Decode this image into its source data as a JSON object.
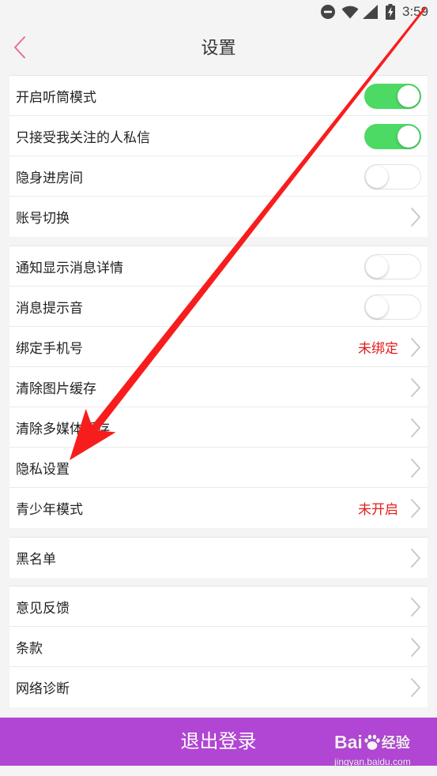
{
  "status_bar": {
    "time": "3:59",
    "icons": [
      "do-not-disturb-icon",
      "wifi-icon",
      "signal-icon",
      "battery-charging-icon"
    ]
  },
  "header": {
    "back_icon": "chevron-left-icon",
    "title": "设置"
  },
  "groups": [
    {
      "items": [
        {
          "label": "开启听筒模式",
          "toggle_on": true
        },
        {
          "label": "只接受我关注的人私信",
          "toggle_on": true
        },
        {
          "label": "隐身进房间",
          "toggle_on": false
        },
        {
          "label": "账号切换",
          "trailing_icon": "chevron-right-icon"
        }
      ]
    },
    {
      "items": [
        {
          "label": "通知显示消息详情",
          "toggle_on": false
        },
        {
          "label": "消息提示音",
          "toggle_on": false
        },
        {
          "label": "绑定手机号",
          "value": "未绑定",
          "trailing_icon": "chevron-right-icon"
        },
        {
          "label": "清除图片缓存",
          "trailing_icon": "chevron-right-icon"
        },
        {
          "label": "清除多媒体缓存",
          "trailing_icon": "chevron-right-icon"
        },
        {
          "label": "隐私设置",
          "trailing_icon": "chevron-right-icon"
        },
        {
          "label": "青少年模式",
          "value": "未开启",
          "trailing_icon": "chevron-right-icon"
        }
      ]
    },
    {
      "items": [
        {
          "label": "黑名单",
          "trailing_icon": "chevron-right-icon"
        }
      ]
    },
    {
      "items": [
        {
          "label": "意见反馈",
          "trailing_icon": "chevron-right-icon"
        },
        {
          "label": "条款",
          "trailing_icon": "chevron-right-icon"
        },
        {
          "label": "网络诊断",
          "trailing_icon": "chevron-right-icon"
        }
      ]
    }
  ],
  "logout_button": {
    "label": "退出登录"
  },
  "watermark": {
    "brand_prefix": "Bai",
    "brand_icon": "paw-logo-icon",
    "brand_suffix": "经验",
    "url": "jingyan.baidu.com"
  },
  "colors": {
    "page_bg": "#f4f4f4",
    "back_chevron": "#ec6d8c",
    "toggle_on": "#4cd964",
    "value_text": "#e31d1a",
    "logout_bg": "#b046d3",
    "annotation_arrow": "#f81d1d"
  }
}
